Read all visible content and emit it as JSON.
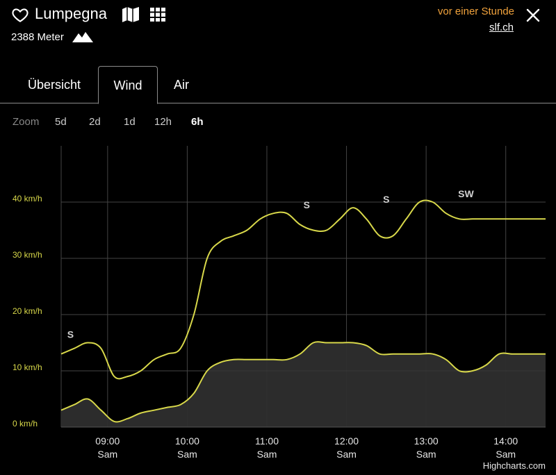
{
  "header": {
    "title": "Lumpegna",
    "elevation": "2388 Meter",
    "updated": "vor einer Stunde",
    "source": "slf.ch"
  },
  "tabs": [
    {
      "label": "Übersicht",
      "active": false
    },
    {
      "label": "Wind",
      "active": true
    },
    {
      "label": "Air",
      "active": false
    }
  ],
  "zoom": {
    "label": "Zoom",
    "options": [
      "5d",
      "2d",
      "1d",
      "12h",
      "6h"
    ],
    "selected": "6h"
  },
  "colors": {
    "series": "#d8d84a",
    "accent": "#f0a23c",
    "area": "#2e2e2e",
    "tick": "#d8d84a"
  },
  "credit": "Highcharts.com",
  "chart_data": {
    "type": "area",
    "y_unit": "km/h",
    "ylim": [
      0,
      50
    ],
    "y_ticks": [
      "0 km/h",
      "10 km/h",
      "20 km/h",
      "30 km/h",
      "40 km/h"
    ],
    "y_tick_values": [
      0,
      10,
      20,
      30,
      40
    ],
    "x_range": [
      "08:25",
      "14:30"
    ],
    "x_ticks": [
      "09:00",
      "10:00",
      "11:00",
      "12:00",
      "13:00",
      "14:00"
    ],
    "x_tick_sub": "Sam",
    "grid": true,
    "series": [
      {
        "role": "gust",
        "x": [
          "08:25",
          "08:35",
          "08:45",
          "08:55",
          "09:05",
          "09:15",
          "09:25",
          "09:35",
          "09:45",
          "09:55",
          "10:05",
          "10:15",
          "10:25",
          "10:35",
          "10:45",
          "10:55",
          "11:05",
          "11:15",
          "11:25",
          "11:35",
          "11:45",
          "11:55",
          "12:05",
          "12:15",
          "12:25",
          "12:35",
          "12:45",
          "12:55",
          "13:05",
          "13:15",
          "13:25",
          "13:35",
          "13:45",
          "13:55",
          "14:05",
          "14:15",
          "14:30"
        ],
        "values": [
          13,
          14,
          15,
          14,
          9,
          9,
          10,
          12,
          13,
          14,
          20,
          30,
          33,
          34,
          35,
          37,
          38,
          38,
          36,
          35,
          35,
          37,
          39,
          37,
          34,
          34,
          37,
          40,
          40,
          38,
          37,
          37,
          37,
          37,
          37,
          37,
          37
        ]
      },
      {
        "role": "mean",
        "x": [
          "08:25",
          "08:35",
          "08:45",
          "08:55",
          "09:05",
          "09:15",
          "09:25",
          "09:35",
          "09:45",
          "09:55",
          "10:05",
          "10:15",
          "10:25",
          "10:35",
          "10:45",
          "10:55",
          "11:05",
          "11:15",
          "11:25",
          "11:35",
          "11:45",
          "11:55",
          "12:05",
          "12:15",
          "12:25",
          "12:35",
          "12:45",
          "12:55",
          "13:05",
          "13:15",
          "13:25",
          "13:35",
          "13:45",
          "13:55",
          "14:05",
          "14:15",
          "14:30"
        ],
        "values": [
          3,
          4,
          5,
          3,
          1,
          1.5,
          2.5,
          3,
          3.5,
          4,
          6,
          10,
          11.5,
          12,
          12,
          12,
          12,
          12,
          13,
          15,
          15,
          15,
          15,
          14.5,
          13,
          13,
          13,
          13,
          13,
          12,
          10,
          10,
          11,
          13,
          13,
          13,
          13
        ]
      }
    ],
    "annotations": [
      {
        "x": "08:32",
        "y": 15,
        "text": "S"
      },
      {
        "x": "11:30",
        "y": 38,
        "text": "S"
      },
      {
        "x": "12:30",
        "y": 39,
        "text": "S"
      },
      {
        "x": "13:30",
        "y": 40,
        "text": "SW"
      }
    ]
  }
}
